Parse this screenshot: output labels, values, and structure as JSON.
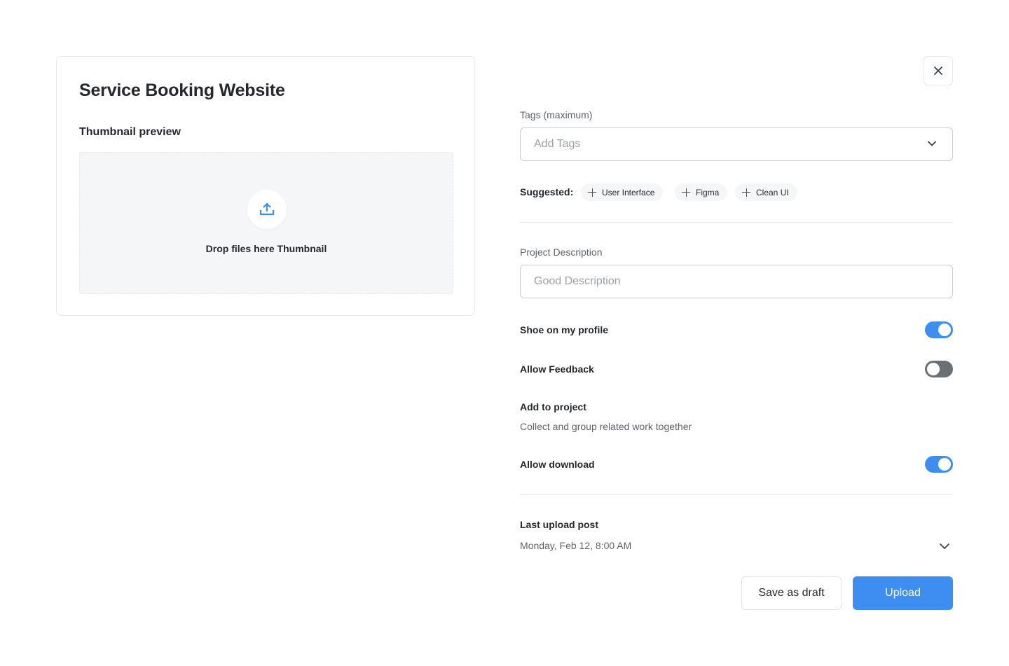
{
  "card": {
    "title": "Service Booking Website",
    "thumbnail_label": "Thumbnail preview",
    "drop_text": "Drop files here Thumbnail",
    "upload_icon": "upload-tray-icon"
  },
  "close_icon": "close-icon",
  "tags": {
    "label": "Tags (maximum)",
    "placeholder": "Add Tags",
    "dropdown_icon": "chevron-down-icon"
  },
  "suggested": {
    "label": "Suggested:",
    "chips": [
      "User Interface",
      "Figma",
      "Clean UI"
    ]
  },
  "description": {
    "label": "Project Description",
    "placeholder": "Good Description"
  },
  "settings": {
    "show_profile": {
      "label": "Shoe on my profile",
      "enabled": true
    },
    "allow_feedback": {
      "label": "Allow Feedback",
      "enabled": false
    },
    "add_to_project": {
      "label": "Add to project",
      "description": "Collect and group related work together"
    },
    "allow_download": {
      "label": "Allow download",
      "enabled": true
    }
  },
  "last_upload": {
    "label": "Last upload post",
    "value": "Monday, Feb 12, 8:00 AM"
  },
  "actions": {
    "draft_label": "Save as draft",
    "upload_label": "Upload"
  },
  "colors": {
    "accent": "#3d8ef0",
    "toggle_off": "#6b7075",
    "border": "#e6e8eb"
  }
}
